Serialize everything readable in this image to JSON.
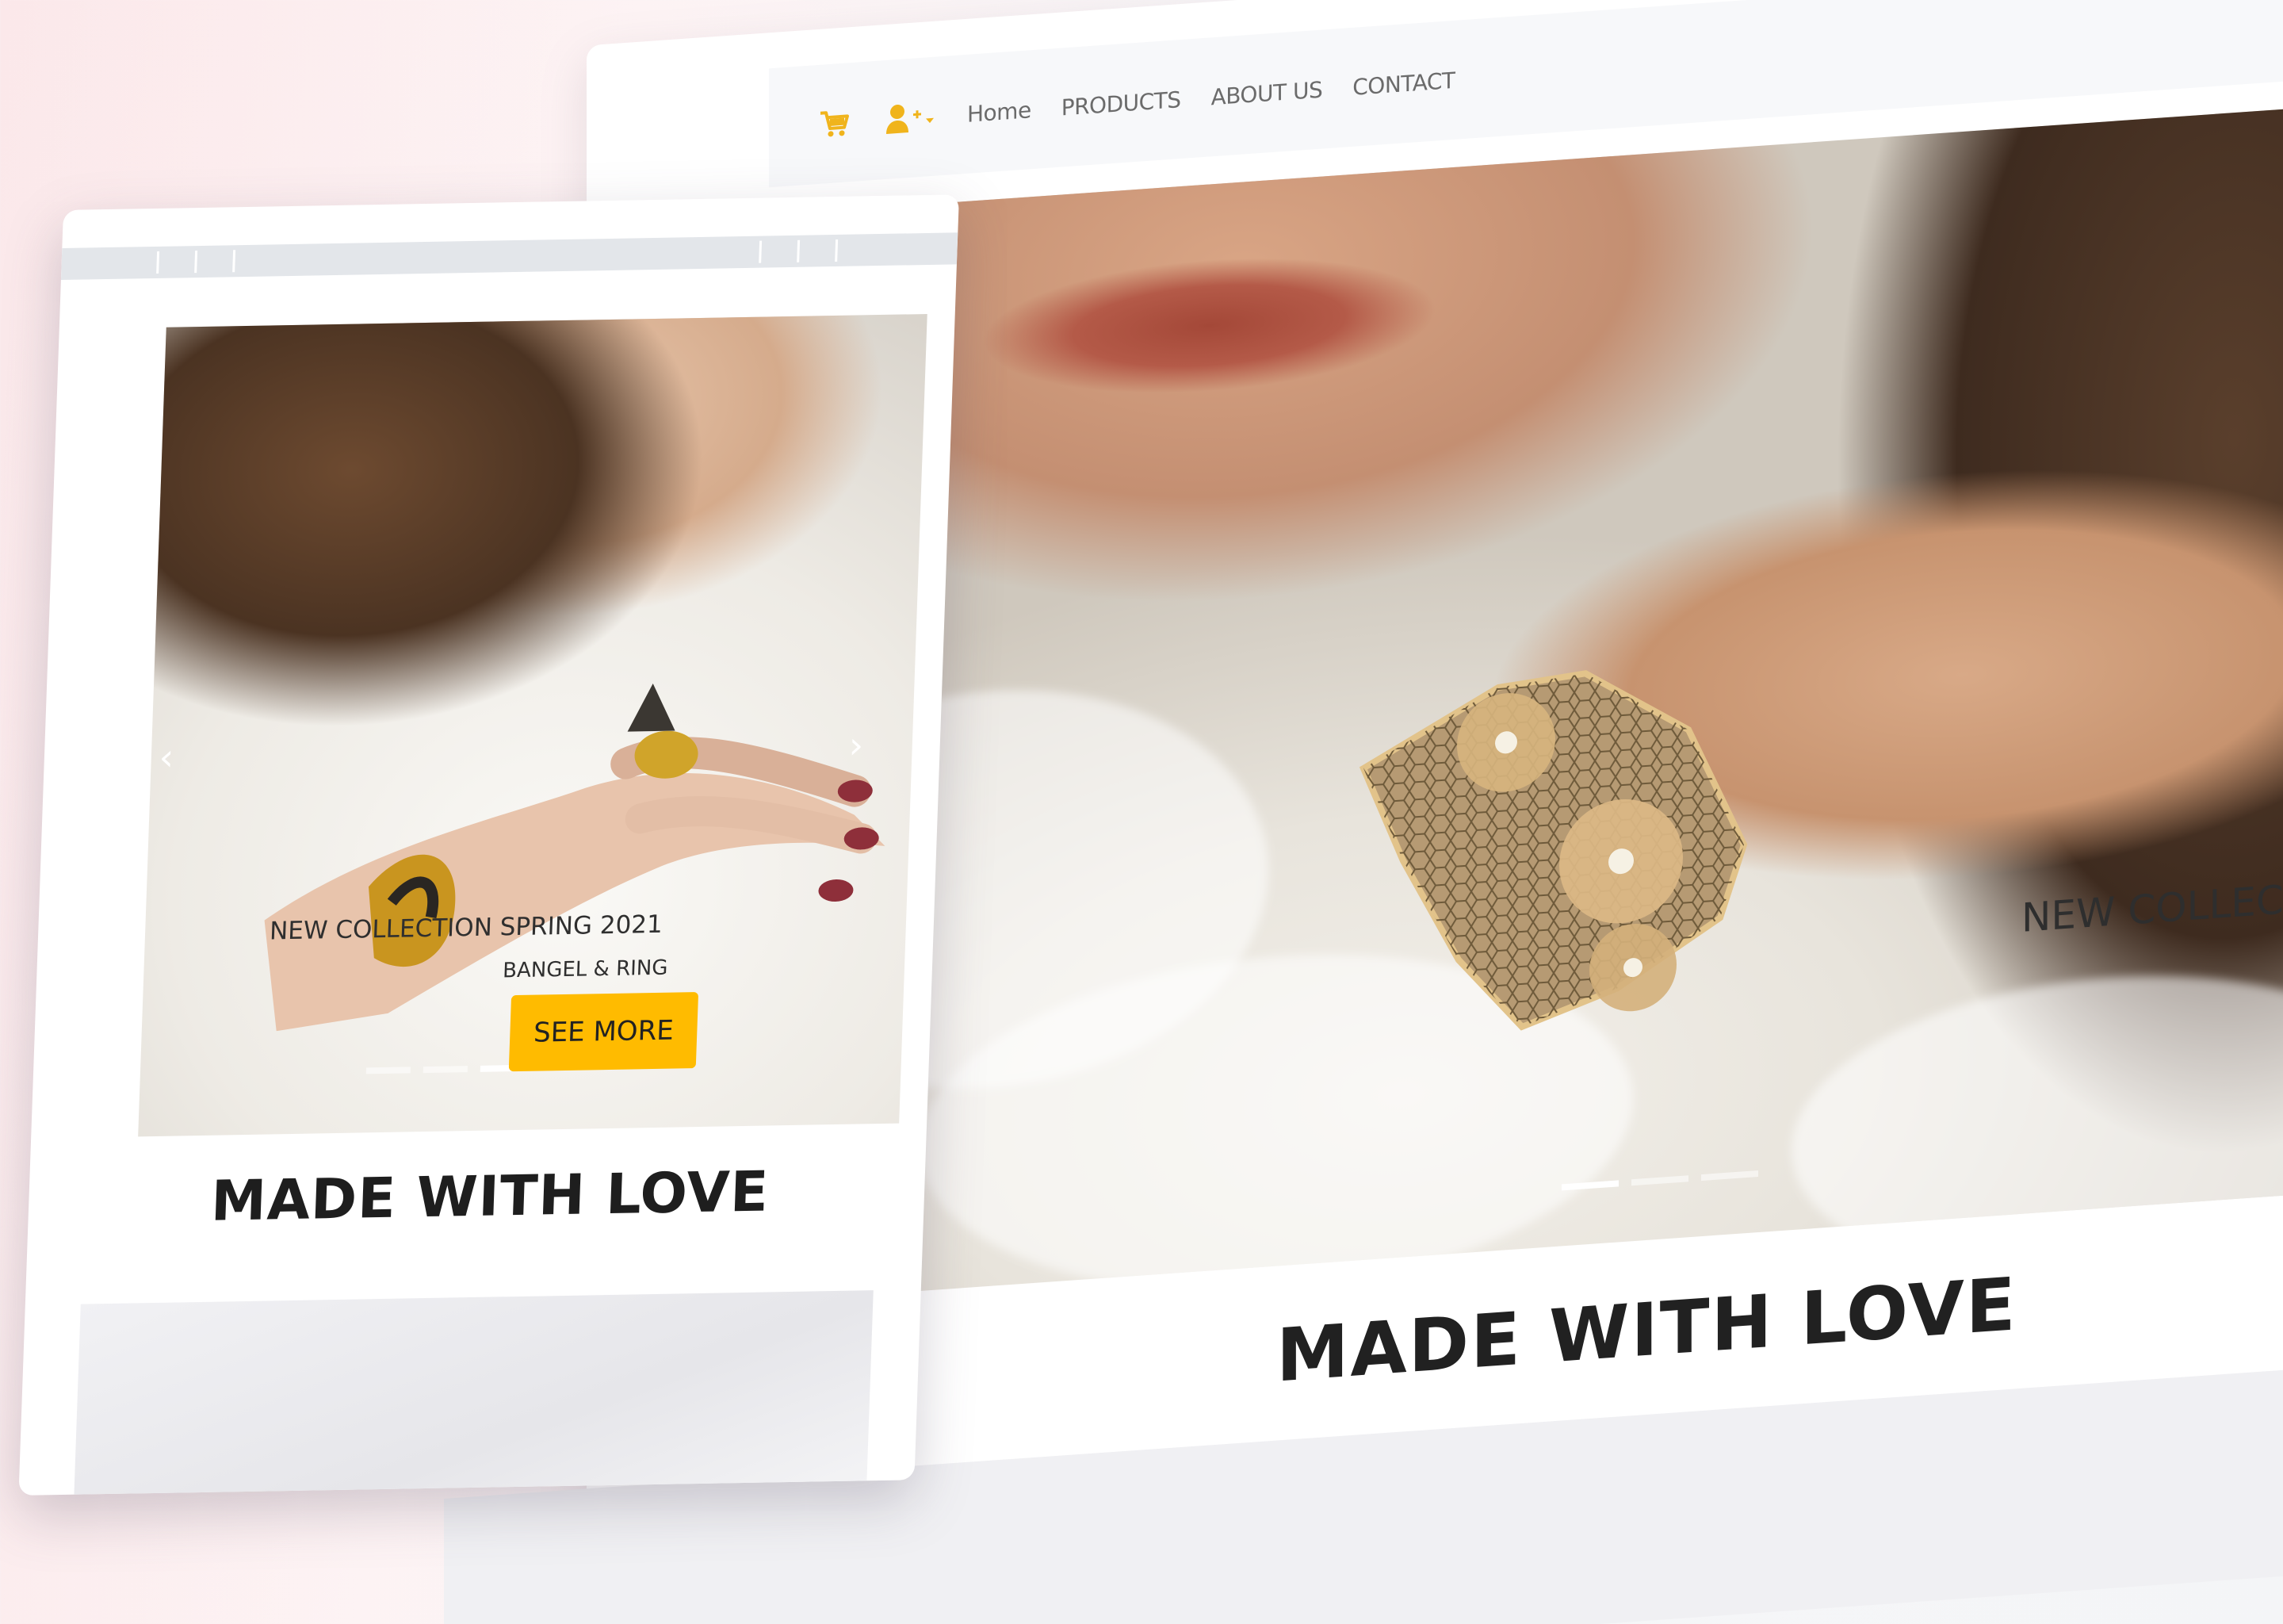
{
  "desktop": {
    "nav": {
      "icons": [
        "cart-icon",
        "user-add-icon",
        "caret-down-icon"
      ],
      "links": [
        "Home",
        "PRODUCTS",
        "ABOUT US",
        "CONTACT"
      ]
    },
    "hero": {
      "caption": "NEW COLLECTION",
      "slides": 3,
      "active_slide": 1
    },
    "heading": "MADE WITH LOVE"
  },
  "mobile": {
    "hero": {
      "title": "NEW COLLECTION SPRING 2021",
      "subtitle": "BANGEL & RING",
      "button_label": "SEE MORE",
      "prev_arrow": "‹",
      "next_arrow": "›",
      "slides": 3,
      "active_slide": 3
    },
    "heading": "MADE WITH LOVE"
  },
  "colors": {
    "accent": "#ffbb00",
    "icon_gold": "#f0b41c",
    "nav_text": "#6b6b6b",
    "heading_text": "#212121"
  }
}
